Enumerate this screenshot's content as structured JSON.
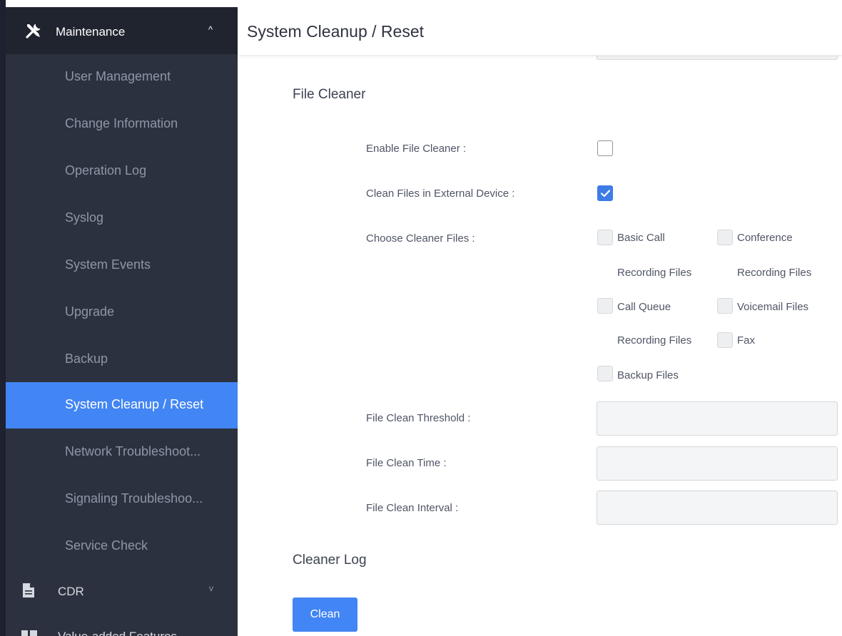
{
  "sidebar": {
    "group": {
      "label": "Maintenance",
      "icon": "tools-icon",
      "caret": "^"
    },
    "items": [
      {
        "label": "User Management",
        "active": false
      },
      {
        "label": "Change Information",
        "active": false
      },
      {
        "label": "Operation Log",
        "active": false
      },
      {
        "label": "Syslog",
        "active": false
      },
      {
        "label": "System Events",
        "active": false
      },
      {
        "label": "Upgrade",
        "active": false
      },
      {
        "label": "Backup",
        "active": false
      },
      {
        "label": "System Cleanup / Reset",
        "active": true
      },
      {
        "label": "Network Troubleshoot...",
        "active": false
      },
      {
        "label": "Signaling Troubleshoo...",
        "active": false
      },
      {
        "label": "Service Check",
        "active": false
      }
    ],
    "cdr": {
      "label": "CDR",
      "icon": "document-icon",
      "caret": "v"
    },
    "next": {
      "label": "Value-added Features",
      "icon": "grid-icon"
    }
  },
  "header": {
    "title": "System Cleanup / Reset"
  },
  "file_cleaner": {
    "title": "File Cleaner",
    "enable_label": "Enable File Cleaner :",
    "enable_checked": false,
    "external_label": "Clean Files in External Device :",
    "external_checked": true,
    "choose_label": "Choose Cleaner Files :",
    "options": {
      "basic_call_1": "Basic Call",
      "basic_call_2": "Recording Files",
      "conference_1": "Conference",
      "conference_2": "Recording Files",
      "call_queue_1": "Call Queue",
      "call_queue_2": "Recording Files",
      "voicemail": "Voicemail Files",
      "fax": "Fax",
      "backup": "Backup Files"
    },
    "threshold_label": "File Clean Threshold :",
    "threshold_value": "",
    "time_label": "File Clean Time :",
    "time_value": "",
    "interval_label": "File Clean Interval :",
    "interval_value": ""
  },
  "cleaner_log": {
    "title": "Cleaner Log",
    "clean_button": "Clean"
  },
  "colors": {
    "accent": "#4285f4",
    "sidebar_bg": "#2c313f",
    "sidebar_header_bg": "#20242f"
  }
}
